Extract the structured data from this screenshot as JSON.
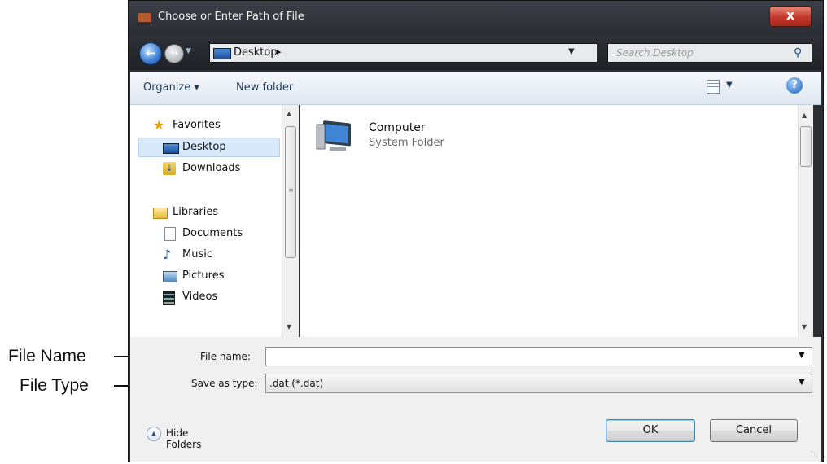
{
  "callouts": {
    "file_name": "File Name",
    "file_type": "File Type"
  },
  "window": {
    "title": "Choose or Enter Path of File",
    "close_label": "x"
  },
  "navigation": {
    "address": "Desktop",
    "address_chevron": "▸",
    "search_placeholder": "Search Desktop"
  },
  "toolbar": {
    "organize": "Organize ▾",
    "new_folder": "New folder",
    "help": "?"
  },
  "nav_pane": {
    "items": [
      {
        "label": "Favorites",
        "icon": "star-icon"
      },
      {
        "label": "Desktop",
        "icon": "desktop-icon",
        "selected": true
      },
      {
        "label": "Downloads",
        "icon": "downloads-folder-icon"
      },
      {
        "label": "Libraries",
        "icon": "libraries-icon"
      },
      {
        "label": "Documents",
        "icon": "documents-icon"
      },
      {
        "label": "Music",
        "icon": "music-icon"
      },
      {
        "label": "Pictures",
        "icon": "pictures-icon"
      },
      {
        "label": "Videos",
        "icon": "videos-icon"
      }
    ]
  },
  "content": {
    "items": [
      {
        "name": "Computer",
        "type": "System Folder",
        "icon": "computer-icon"
      }
    ]
  },
  "form": {
    "file_name_label": "File name:",
    "file_name_value": "",
    "save_type_label": "Save as type:",
    "save_type_value": ".dat (*.dat)"
  },
  "footer": {
    "hide_folders": "Hide Folders",
    "ok": "OK",
    "cancel": "Cancel"
  },
  "colors": {
    "frame": "#2b2e33",
    "selection": "#d7e9fb",
    "close_button": "#c2382a"
  }
}
